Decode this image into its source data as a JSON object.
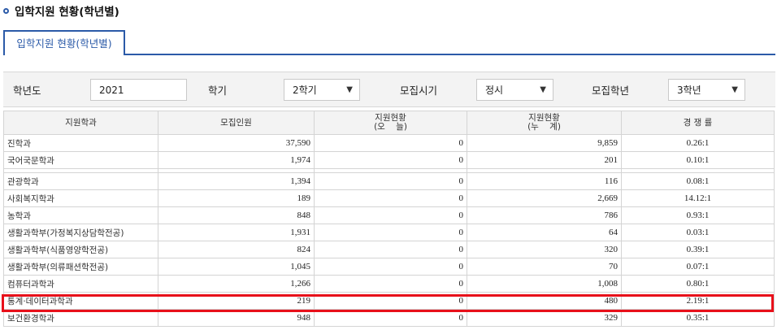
{
  "page": {
    "title": "입학지원 현황(학년별)"
  },
  "tab": {
    "label": "입학지원 현황(학년별)"
  },
  "filters": {
    "year_label": "학년도",
    "year_value": "2021",
    "semester_label": "학기",
    "semester_value": "2학기",
    "period_label": "모집시기",
    "period_value": "정시",
    "grade_label": "모집학년",
    "grade_value": "3학년"
  },
  "table": {
    "headers": {
      "dept": "지원학과",
      "quota": "모집인원",
      "today_l1": "지원현황",
      "today_l2": "(오    늘)",
      "cum_l1": "지원현황",
      "cum_l2": "(누    계)",
      "ratio": "경 쟁 률"
    },
    "rows": [
      {
        "dept": "진학과",
        "quota": "37,590",
        "today": "0",
        "cum": "9,859",
        "ratio": "0.26:1"
      },
      {
        "dept": "국어국문학과",
        "quota": "1,974",
        "today": "0",
        "cum": "201",
        "ratio": "0.10:1"
      },
      {
        "dept": "관광학과",
        "quota": "1,394",
        "today": "0",
        "cum": "116",
        "ratio": "0.08:1"
      },
      {
        "dept": "사회복지학과",
        "quota": "189",
        "today": "0",
        "cum": "2,669",
        "ratio": "14.12:1"
      },
      {
        "dept": "농학과",
        "quota": "848",
        "today": "0",
        "cum": "786",
        "ratio": "0.93:1"
      },
      {
        "dept": "생활과학부(가정복지상담학전공)",
        "quota": "1,931",
        "today": "0",
        "cum": "64",
        "ratio": "0.03:1"
      },
      {
        "dept": "생활과학부(식품영양학전공)",
        "quota": "824",
        "today": "0",
        "cum": "320",
        "ratio": "0.39:1"
      },
      {
        "dept": "생활과학부(의류패션학전공)",
        "quota": "1,045",
        "today": "0",
        "cum": "70",
        "ratio": "0.07:1"
      },
      {
        "dept": "컴퓨터과학과",
        "quota": "1,266",
        "today": "0",
        "cum": "1,008",
        "ratio": "0.80:1"
      },
      {
        "dept": "통계·데이터과학과",
        "quota": "219",
        "today": "0",
        "cum": "480",
        "ratio": "2.19:1"
      },
      {
        "dept": "보건환경학과",
        "quota": "948",
        "today": "0",
        "cum": "329",
        "ratio": "0.35:1"
      }
    ]
  },
  "colors": {
    "accent": "#2b5aa8",
    "highlight": "#e8101a"
  }
}
